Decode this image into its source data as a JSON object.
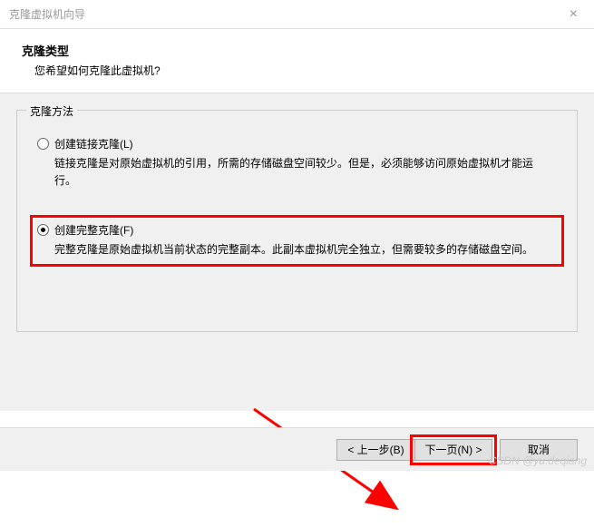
{
  "titlebar": {
    "title": "克隆虚拟机向导",
    "close": "×"
  },
  "header": {
    "title": "克隆类型",
    "subtitle": "您希望如何克隆此虚拟机?"
  },
  "fieldset": {
    "legend": "克隆方法"
  },
  "options": {
    "linked": {
      "label": "创建链接克隆(L)",
      "desc": "链接克隆是对原始虚拟机的引用，所需的存储磁盘空间较少。但是，必须能够访问原始虚拟机才能运行。"
    },
    "full": {
      "label": "创建完整克隆(F)",
      "desc": "完整克隆是原始虚拟机当前状态的完整副本。此副本虚拟机完全独立，但需要较多的存储磁盘空间。"
    }
  },
  "buttons": {
    "back": "< 上一步(B)",
    "next": "下一页(N) >",
    "cancel": "取消"
  },
  "watermark": "CSDN @yu.deqiang"
}
